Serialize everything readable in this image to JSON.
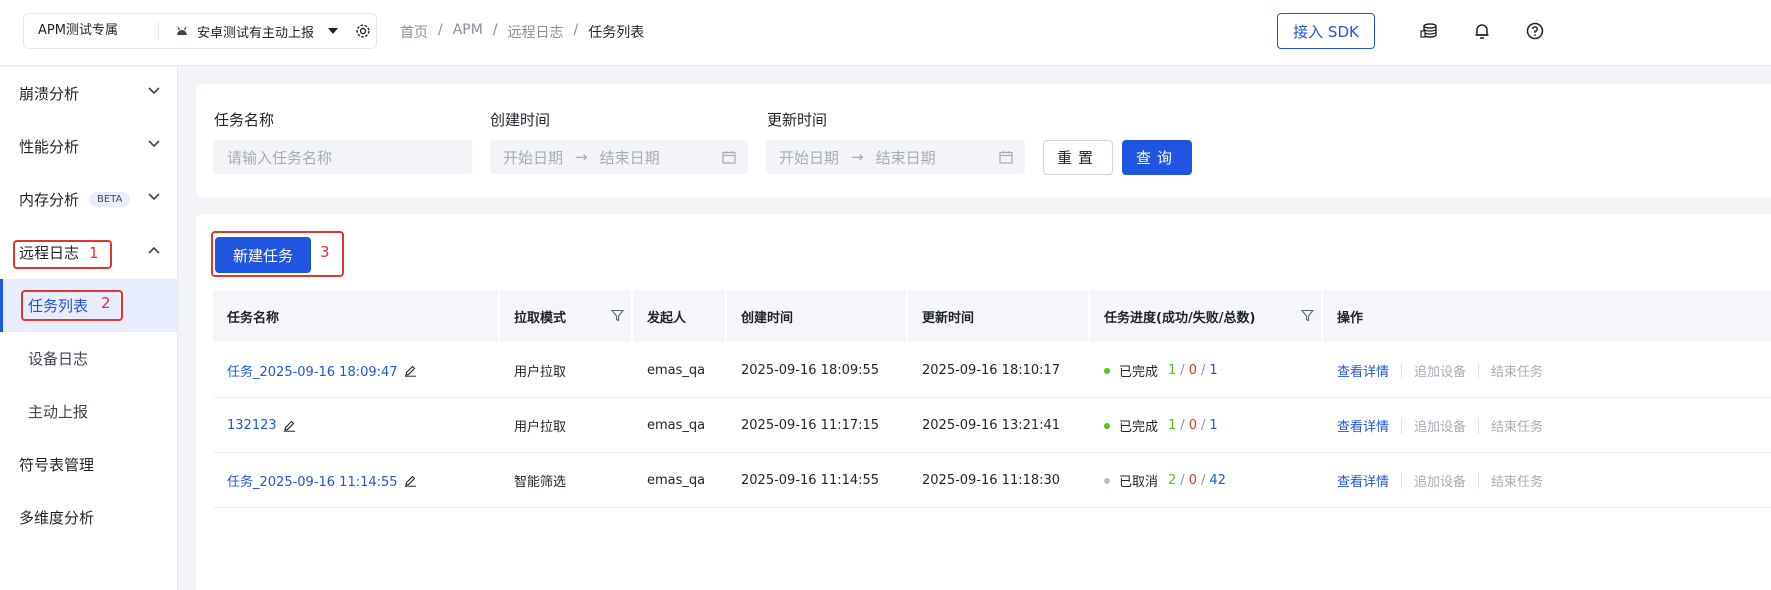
{
  "header": {
    "app_name": "APM测试专属",
    "platform": "安卓测试有主动上报",
    "breadcrumb": [
      "首页",
      "APM",
      "远程日志",
      "任务列表"
    ],
    "sdk_button": "接入 SDK",
    "icons": [
      "coins-icon",
      "bell-icon",
      "help-icon"
    ]
  },
  "sidebar": {
    "items": [
      {
        "label": "崩溃分析"
      },
      {
        "label": "性能分析"
      },
      {
        "label": "内存分析",
        "badge": "BETA"
      },
      {
        "label": "远程日志"
      },
      {
        "label": "符号表管理"
      },
      {
        "label": "多维度分析"
      }
    ],
    "sub_items": [
      {
        "label": "任务列表",
        "active": true
      },
      {
        "label": "设备日志"
      },
      {
        "label": "主动上报"
      }
    ]
  },
  "annotations": [
    "1",
    "2",
    "3"
  ],
  "filter": {
    "task_name_label": "任务名称",
    "task_name_placeholder": "请输入任务名称",
    "created_label": "创建时间",
    "updated_label": "更新时间",
    "start_placeholder": "开始日期",
    "end_placeholder": "结束日期",
    "reset": "重置",
    "query": "查询"
  },
  "table": {
    "new_task": "新建任务",
    "columns": [
      "任务名称",
      "拉取模式",
      "发起人",
      "创建时间",
      "更新时间",
      "任务进度(成功/失败/总数)",
      "操作"
    ],
    "rows": [
      {
        "name": "任务_2025-09-16 18:09:47",
        "mode": "用户拉取",
        "owner": "emas_qa",
        "created": "2025-09-16 18:09:55",
        "updated": "2025-09-16 18:10:17",
        "status": "已完成",
        "success": "1",
        "fail": "0",
        "total": "1",
        "status_color": "#52c41a"
      },
      {
        "name": "132123",
        "mode": "用户拉取",
        "owner": "emas_qa",
        "created": "2025-09-16 11:17:15",
        "updated": "2025-09-16 13:21:41",
        "status": "已完成",
        "success": "1",
        "fail": "0",
        "total": "1",
        "status_color": "#52c41a"
      },
      {
        "name": "任务_2025-09-16 11:14:55",
        "mode": "智能筛选",
        "owner": "emas_qa",
        "created": "2025-09-16 11:14:55",
        "updated": "2025-09-16 11:18:30",
        "status": "已取消",
        "success": "2",
        "fail": "0",
        "total": "42",
        "status_color": "#b8bcc4"
      }
    ],
    "ops": [
      "查看详情",
      "追加设备",
      "结束任务"
    ]
  },
  "colors": {
    "primary": "#1f55e0",
    "success": "#52c41a",
    "fail": "#e0362c",
    "annotation": "#e0362c"
  }
}
